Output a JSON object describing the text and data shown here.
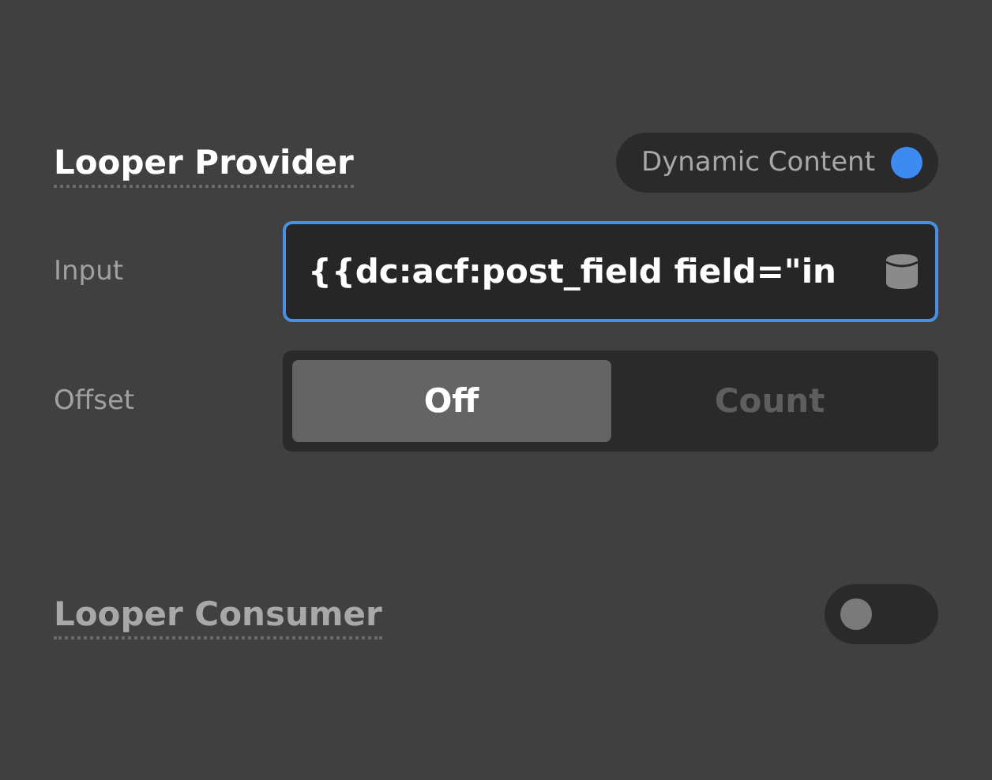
{
  "sections": [
    {
      "title": "Looper Provider",
      "toggle": {
        "label": "Dynamic Content",
        "on": true
      },
      "fields": [
        {
          "kind": "input",
          "label": "Input",
          "value": "{{dc:acf:post_field field=\"in",
          "focused": true
        },
        {
          "kind": "segmented",
          "label": "Offset",
          "options": [
            {
              "label": "Off",
              "selected": true
            },
            {
              "label": "Count",
              "selected": false
            }
          ]
        }
      ]
    },
    {
      "title": "Looper Consumer",
      "toggle": {
        "on": false
      }
    }
  ]
}
